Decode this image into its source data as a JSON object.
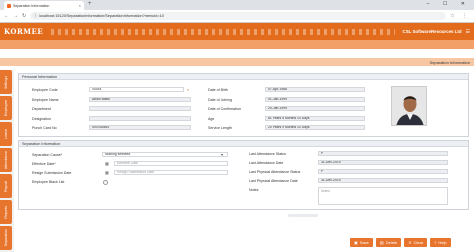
{
  "browser": {
    "tab_title": "Separation Information",
    "url": "localhost:15120/SeparationInformation/SeparationInformation?menuId=10"
  },
  "app": {
    "logo": "KORMEE",
    "company": "CSL SoftwareResources Ltd",
    "page_title": "Separation Information",
    "accent": "#e8752e"
  },
  "sidebar": {
    "items": [
      "Settings",
      "Employee",
      "Leave",
      "Attendance",
      "Payroll",
      "Reports",
      "Separation"
    ]
  },
  "personal": {
    "title": "Personal Information",
    "employee_code_label": "Employee Code",
    "employee_code": "00444",
    "employee_name_label": "Employee Name",
    "employee_name": "Abdul Matin",
    "department_label": "Department",
    "department": "",
    "designation_label": "Designation",
    "designation": "",
    "punch_card_label": "Punch Card No",
    "punch_card": "000760864",
    "dob_label": "Date of Birth",
    "dob": "07-Apr-1988",
    "doj_label": "Date of Joining",
    "doj": "01-Jan-1999",
    "doc_label": "Date of Confirmation",
    "doc": "20-Jan-1999",
    "age_label": "Age",
    "age": "61 Years 5 Months 14 Days",
    "service_label": "Service Length",
    "service": "20 Years 9 Months 10 Days"
  },
  "separation": {
    "title": "Separation Information",
    "cause_label": "Separation Cause*",
    "cause_value": "Nothing selected",
    "effective_label": "Effective Date*",
    "effective_placeholder": "Effective Date",
    "resign_label": "Resign Submission Date",
    "resign_placeholder": "Resign Submission Date",
    "blacklist_label": "Employee Black List",
    "last_status_label": "Last Attendance Status",
    "last_status": "P",
    "last_date_label": "Last Attendance Date",
    "last_date": "31-Dec-2019",
    "last_phys_status_label": "Last Physical Attendance Status",
    "last_phys_status": "P",
    "last_phys_date_label": "Last Physical Attendance Date",
    "last_phys_date": "31-Dec-2019",
    "notes_label": "Notes",
    "notes_placeholder": "Notes"
  },
  "actions": {
    "save": "Save",
    "delete": "Delete",
    "clear": "Clear",
    "help": "Help"
  }
}
